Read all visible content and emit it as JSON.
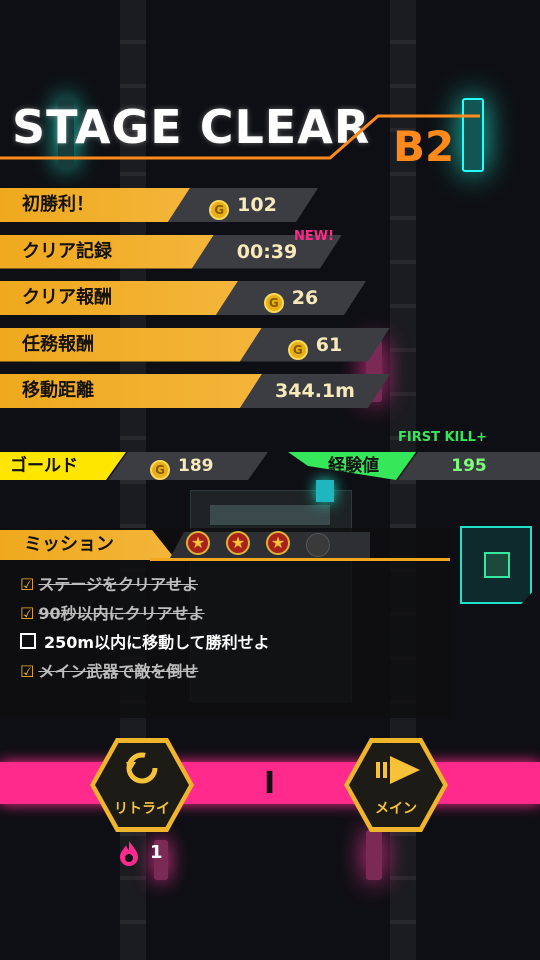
{
  "header": {
    "title": "STAGE CLEAR",
    "floor": "B2"
  },
  "rewards": [
    {
      "label": "初勝利！",
      "value": "102",
      "coin": true,
      "badge": ""
    },
    {
      "label": "クリア記録",
      "value": "00:39",
      "coin": false,
      "badge": "NEW!"
    },
    {
      "label": "クリア報酬",
      "value": "26",
      "coin": true,
      "badge": ""
    },
    {
      "label": "任務報酬",
      "value": "61",
      "coin": true,
      "badge": ""
    },
    {
      "label": "移動距離",
      "value": "344.1m",
      "coin": false,
      "badge": ""
    }
  ],
  "totals": {
    "gold_label": "ゴールド",
    "gold_value": "189",
    "exp_label": "経験値",
    "exp_value": "195",
    "exp_note": "FIRST KILL+"
  },
  "mission": {
    "title": "ミッション",
    "stars_earned": 3,
    "stars_total": 4,
    "items": [
      {
        "text": "ステージをクリアせよ",
        "done": true
      },
      {
        "text": "90秒以内にクリアせよ",
        "done": true
      },
      {
        "text": "250m以内に移動して勝利せよ",
        "done": false
      },
      {
        "text": "メイン武器で敵を倒せ",
        "done": true
      }
    ]
  },
  "buttons": {
    "retry_label": "リトライ",
    "main_label": "メイン",
    "retry_count": "1",
    "center_mark": "I"
  },
  "colors": {
    "accent": "#f0a91e",
    "gold": "#ffe600",
    "exp": "#35e85a",
    "bar": "#ff2a8c",
    "teal": "#1fe0c8"
  },
  "icons": {
    "coin": "coin-icon",
    "retry": "retry-icon",
    "main": "arrow-right-icon",
    "flame": "flame-icon",
    "star": "star-icon"
  }
}
